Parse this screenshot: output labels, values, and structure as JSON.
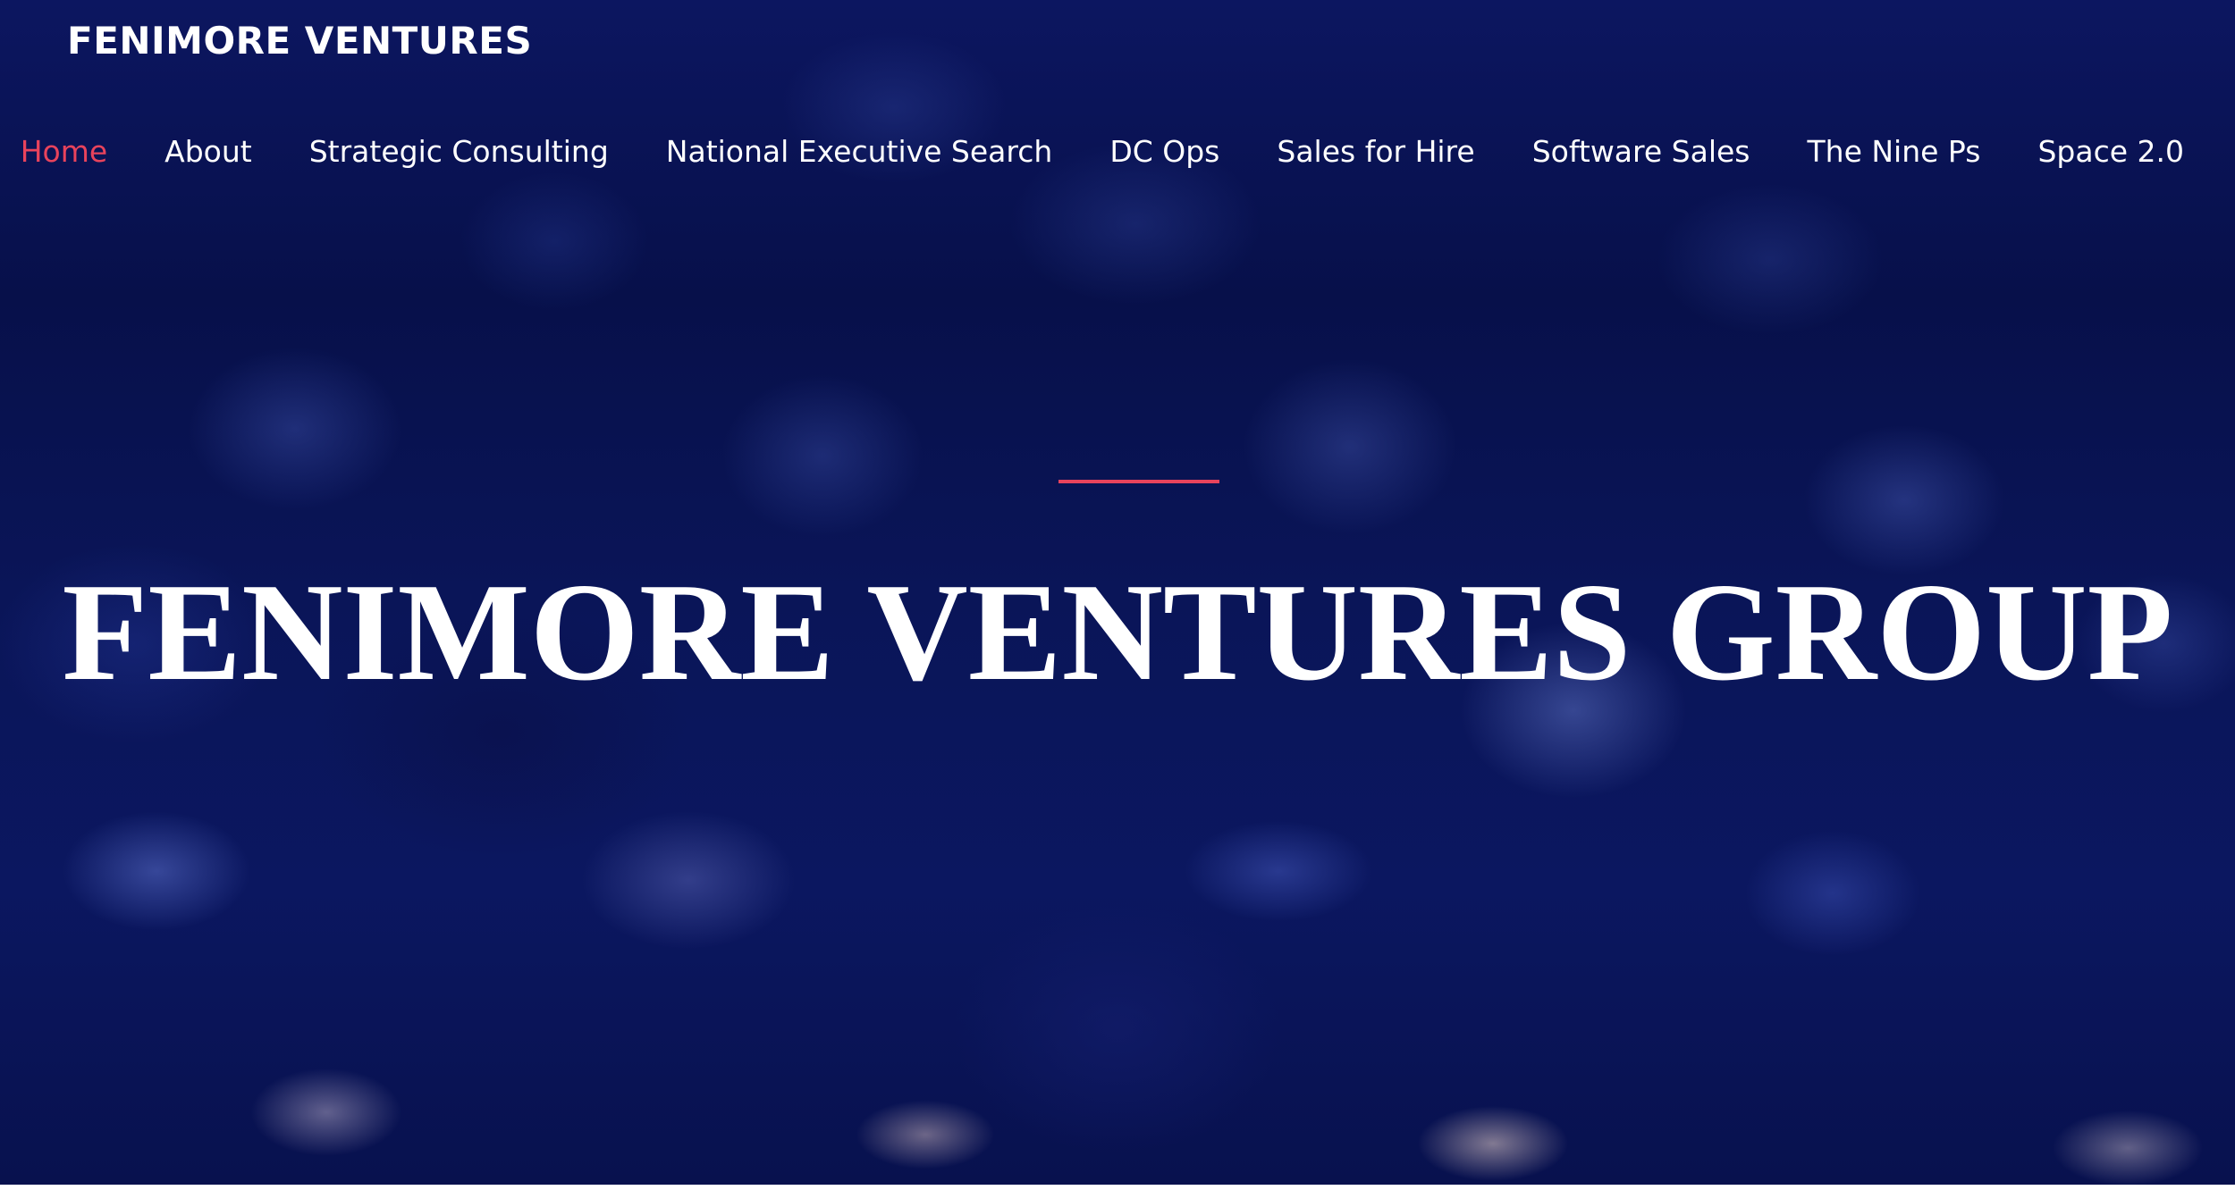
{
  "header": {
    "site_title": "FENIMORE VENTURES"
  },
  "nav": {
    "items": [
      {
        "label": "Home",
        "active": true
      },
      {
        "label": "About"
      },
      {
        "label": "Strategic Consulting"
      },
      {
        "label": "National Executive Search"
      },
      {
        "label": "DC Ops"
      },
      {
        "label": "Sales for Hire"
      },
      {
        "label": "Software Sales"
      },
      {
        "label": "The Nine Ps"
      },
      {
        "label": "Space 2.0"
      }
    ]
  },
  "hero": {
    "title": "FENIMORE VENTURES GROUP"
  },
  "colors": {
    "accent": "#e8435c",
    "background": "#0a1558",
    "text": "#ffffff"
  }
}
